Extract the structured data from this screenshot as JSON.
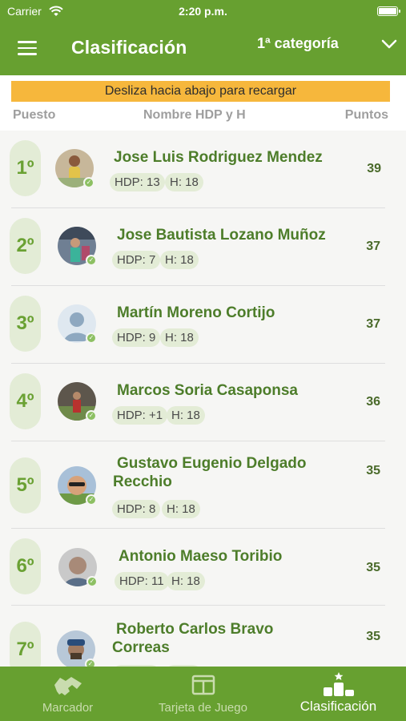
{
  "status": {
    "carrier": "Carrier",
    "time": "2:20 p.m."
  },
  "header": {
    "title": "Clasificación",
    "category": "1ª categoría"
  },
  "banner": "Desliza hacia abajo para recargar",
  "columns": {
    "position": "Puesto",
    "name": "Nombre HDP y H",
    "points": "Puntos"
  },
  "players": [
    {
      "pos": "1º",
      "name": "Jose Luis Rodriguez Mendez",
      "name2": "",
      "hdp": "HDP: 13",
      "h": "H: 18",
      "pts": "39"
    },
    {
      "pos": "2º",
      "name": "Jose Bautista Lozano Muñoz",
      "name2": "",
      "hdp": "HDP: 7",
      "h": "H: 18",
      "pts": "37"
    },
    {
      "pos": "3º",
      "name": "Martín Moreno Cortijo",
      "name2": "",
      "hdp": "HDP: 9",
      "h": "H: 18",
      "pts": "37"
    },
    {
      "pos": "4º",
      "name": "Marcos Soria Casaponsa",
      "name2": "",
      "hdp": "HDP: +1",
      "h": "H: 18",
      "pts": "36"
    },
    {
      "pos": "5º",
      "name": "Gustavo Eugenio Delgado",
      "name2": "Recchio",
      "hdp": "HDP: 8",
      "h": "H: 18",
      "pts": "35"
    },
    {
      "pos": "6º",
      "name": "Antonio Maeso Toribio",
      "name2": "",
      "hdp": "HDP: 11",
      "h": "H: 18",
      "pts": "35"
    },
    {
      "pos": "7º",
      "name": "Roberto Carlos Bravo",
      "name2": "Correas",
      "hdp": "",
      "h": "",
      "pts": "35"
    }
  ],
  "tabs": [
    {
      "label": "Marcador",
      "icon": "handshake-icon"
    },
    {
      "label": "Tarjeta de Juego",
      "icon": "scorecard-icon"
    },
    {
      "label": "Clasificación",
      "icon": "podium-icon"
    }
  ],
  "colors": {
    "primary": "#67a030",
    "accent": "#f6b73c",
    "chip": "#e3ecd6"
  }
}
